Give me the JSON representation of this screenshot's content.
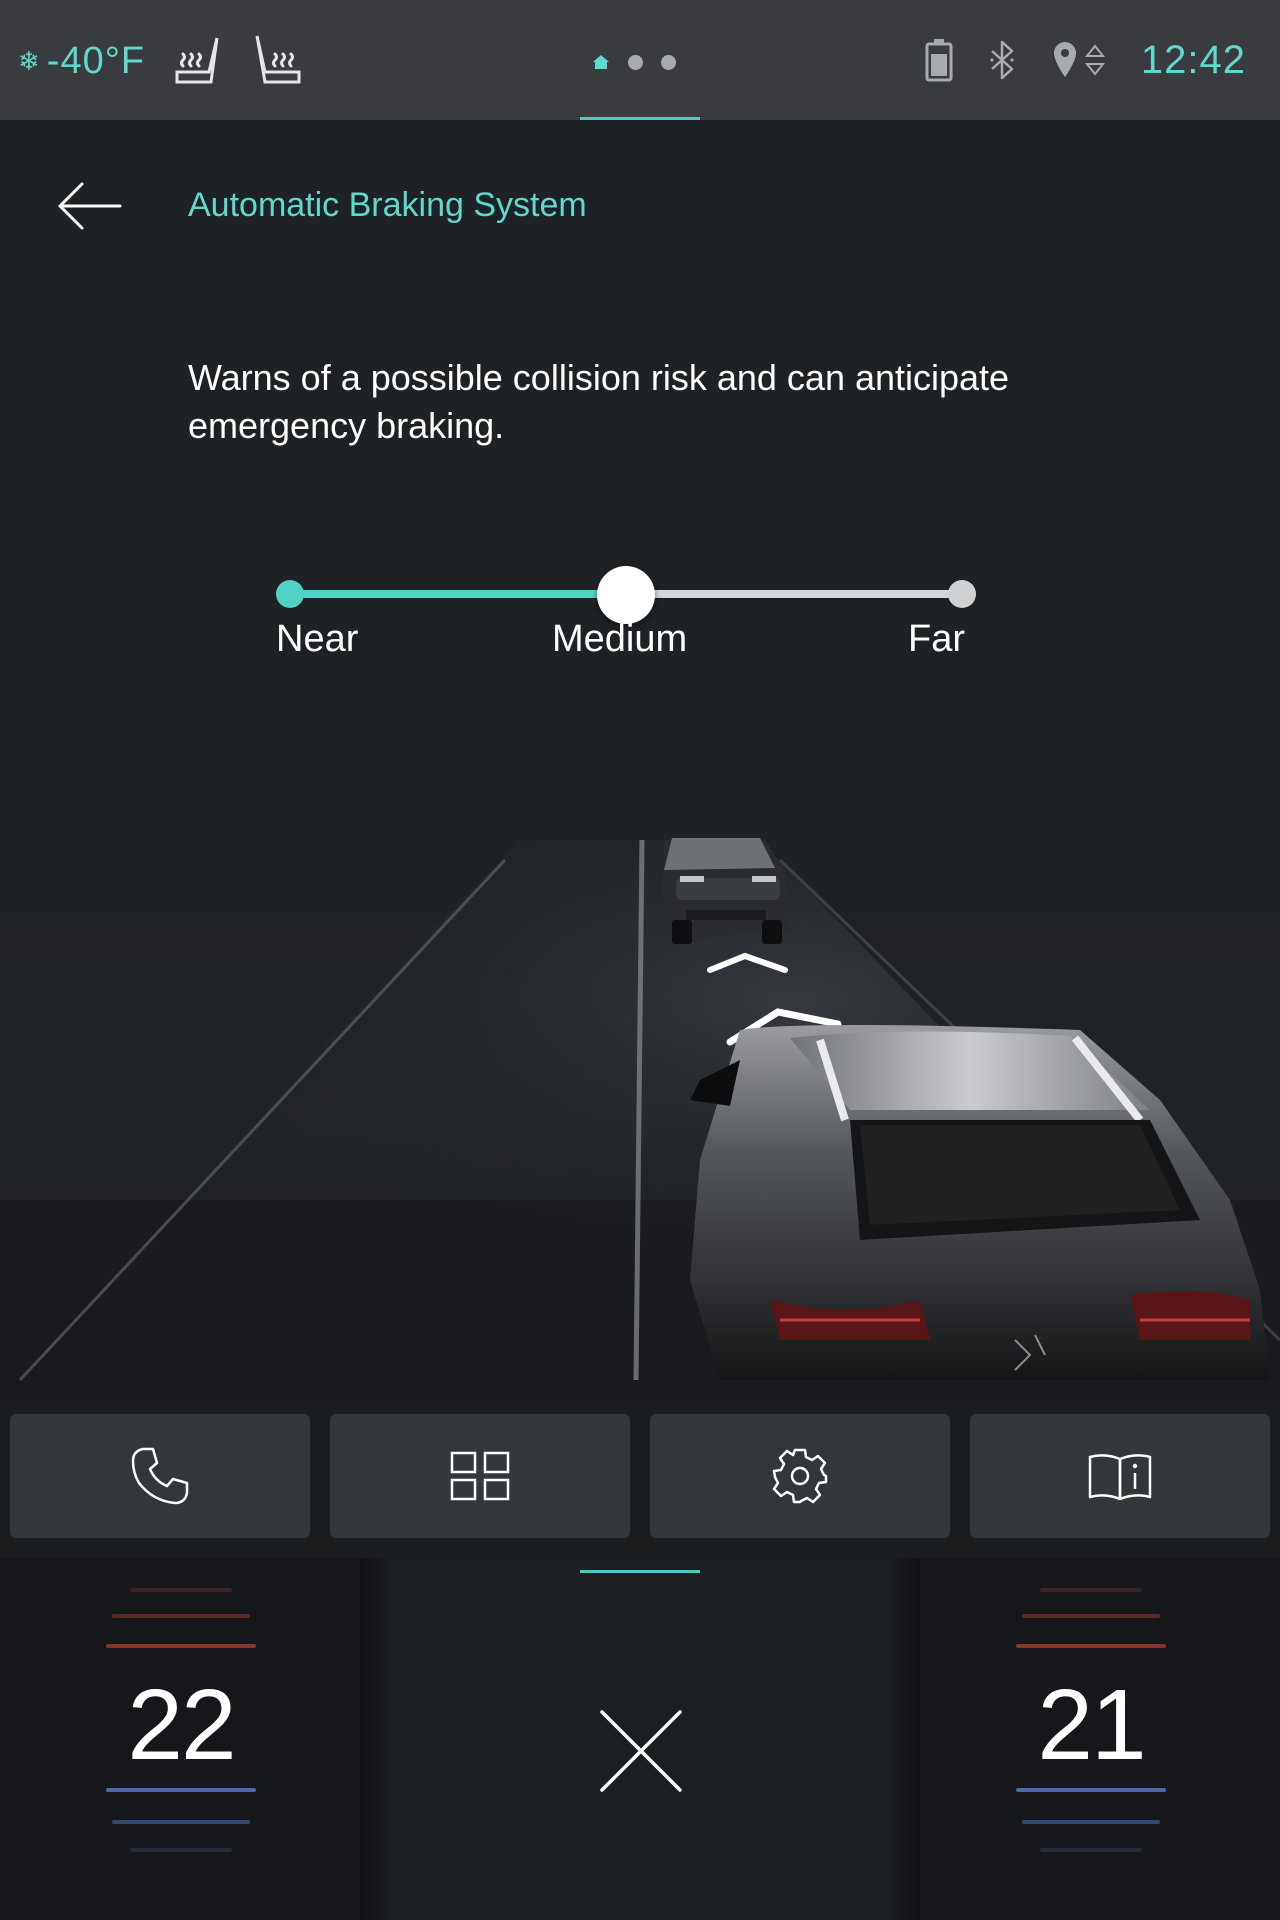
{
  "status_bar": {
    "outside_temp": "-40°F",
    "clock": "12:42",
    "accent_color": "#5fd8cd"
  },
  "header": {
    "title": "Automatic Braking System"
  },
  "description": "Warns of a possible collision risk and can anticipate emergency braking.",
  "slider": {
    "options": [
      "Near",
      "Medium",
      "Far"
    ],
    "selected": "Medium",
    "selected_fraction": 0.5
  },
  "quick_buttons": [
    {
      "icon": "phone-icon"
    },
    {
      "icon": "apps-grid-icon"
    },
    {
      "icon": "settings-gear-icon"
    },
    {
      "icon": "manual-book-icon"
    }
  ],
  "climate": {
    "left_temp": "22",
    "right_temp": "21"
  }
}
